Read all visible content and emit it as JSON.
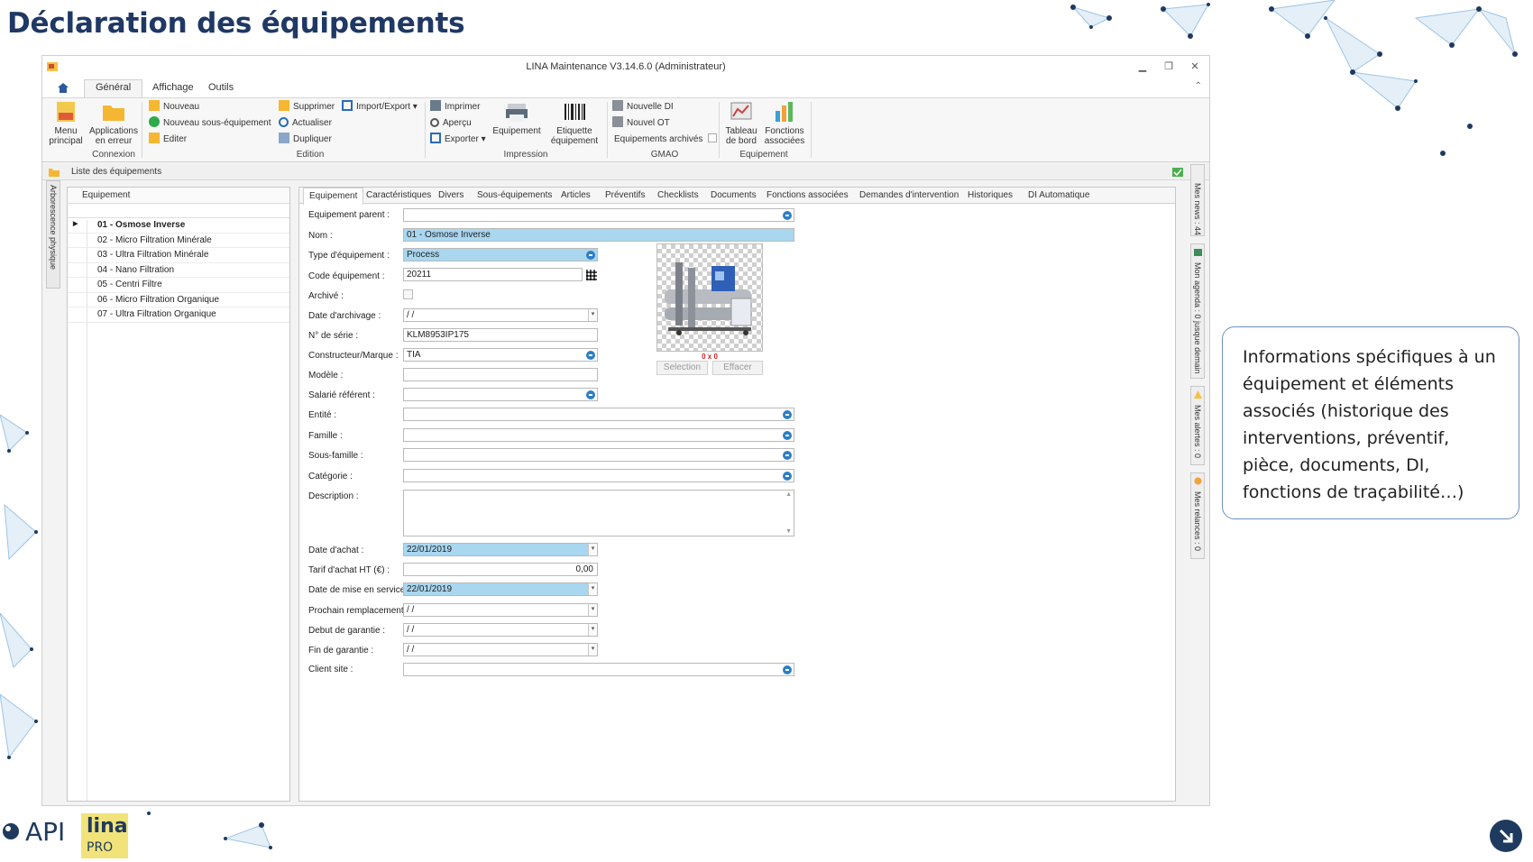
{
  "slide": {
    "title": "Déclaration des équipements"
  },
  "window": {
    "title": "LINA Maintenance  V3.14.6.0  (Administrateur)"
  },
  "ribbon_tabs": [
    "Général",
    "Affichage",
    "Outils"
  ],
  "ribbon": {
    "connexion": {
      "menu_principal": "Menu principal",
      "applications_erreur": "Applications en erreur",
      "group": "Connexion"
    },
    "edition": {
      "nouveau": "Nouveau",
      "nouveau_sous": "Nouveau sous-équipement",
      "editer": "Editer",
      "supprimer": "Supprimer",
      "actualiser": "Actualiser",
      "dupliquer": "Dupliquer",
      "import_export": "Import/Export",
      "group": "Edition"
    },
    "impression": {
      "imprimer": "Imprimer",
      "apercu": "Aperçu",
      "exporter": "Exporter",
      "equipement": "Equipement",
      "etiquette": "Etiquette équipement",
      "group": "Impression"
    },
    "gmao": {
      "nouvelle_di": "Nouvelle DI",
      "nouvel_ot": "Nouvel OT",
      "archives": "Equipements archivés",
      "group": "GMAO"
    },
    "equipement": {
      "tableau": "Tableau de bord",
      "fonctions": "Fonctions associées",
      "group": "Equipement"
    }
  },
  "panel": {
    "title": "Liste des équipements",
    "left_vtab": "Arborescence physique",
    "tree_header": "Equipement",
    "items": [
      "01 - Osmose Inverse",
      "02 - Micro Filtration Minérale",
      "03 - Ultra Filtration Minérale",
      "04 - Nano Filtration",
      "05 - Centri Filtre",
      "06 - Micro Filtration Organique",
      "07 - Ultra Filtration Organique"
    ]
  },
  "form_tabs": [
    "Equipement",
    "Caractéristiques",
    "Divers",
    "Sous-équipements",
    "Articles",
    "Préventifs",
    "Checklists",
    "Documents",
    "Fonctions associées",
    "Demandes d'intervention",
    "Historiques",
    "DI Automatique"
  ],
  "form": {
    "labels": {
      "parent": "Equipement parent :",
      "nom": "Nom :",
      "type": "Type d'équipement :",
      "code": "Code équipement :",
      "archive": "Archivé :",
      "date_archivage": "Date d'archivage :",
      "serie": "N° de série :",
      "constructeur": "Constructeur/Marque :",
      "modele": "Modèle :",
      "salarie": "Salarié référent :",
      "entite": "Entité :",
      "famille": "Famille :",
      "sous_famille": "Sous-famille :",
      "categorie": "Catégorie :",
      "description": "Description :",
      "date_achat": "Date d'achat :",
      "tarif": "Tarif d'achat HT (€) :",
      "date_service": "Date de mise en service :",
      "prochain": "Prochain remplacement :",
      "debut_garantie": "Debut de garantie :",
      "fin_garantie": "Fin de garantie :",
      "client_site": "Client site :"
    },
    "values": {
      "parent": "",
      "nom": "01 - Osmose Inverse",
      "type": "Process",
      "code": "20211",
      "date_archivage": "  /   /",
      "serie": "KLM8953IP175",
      "constructeur": "TIA",
      "modele": "",
      "salarie": "",
      "entite": "",
      "famille": "",
      "sous_famille": "",
      "categorie": "",
      "description": "",
      "date_achat": "22/01/2019",
      "tarif": "0,00",
      "date_service": "22/01/2019",
      "prochain": "  /   /",
      "debut_garantie": "  /   /",
      "fin_garantie": "  /   /",
      "client_site": ""
    },
    "image": {
      "size": "0 x 0",
      "selection": "Selection",
      "effacer": "Effacer"
    }
  },
  "right_sidebar": {
    "news": "Mes news : 44",
    "agenda": "Mon agenda : 0 jusque demain",
    "alertes": "Mes alertes : 0",
    "relances": "Mes relances : 0"
  },
  "callout": {
    "text": "Informations spécifiques à un équipement et éléments associés (historique des interventions, préventif, pièce, documents, DI, fonctions de traçabilité…)"
  },
  "logos": {
    "api": "API",
    "lina": "lina",
    "pro": "PRO"
  },
  "colors": {
    "title": "#1f3864",
    "field_highlight": "#a9d7f0",
    "callout_border": "#6d8fc2"
  }
}
